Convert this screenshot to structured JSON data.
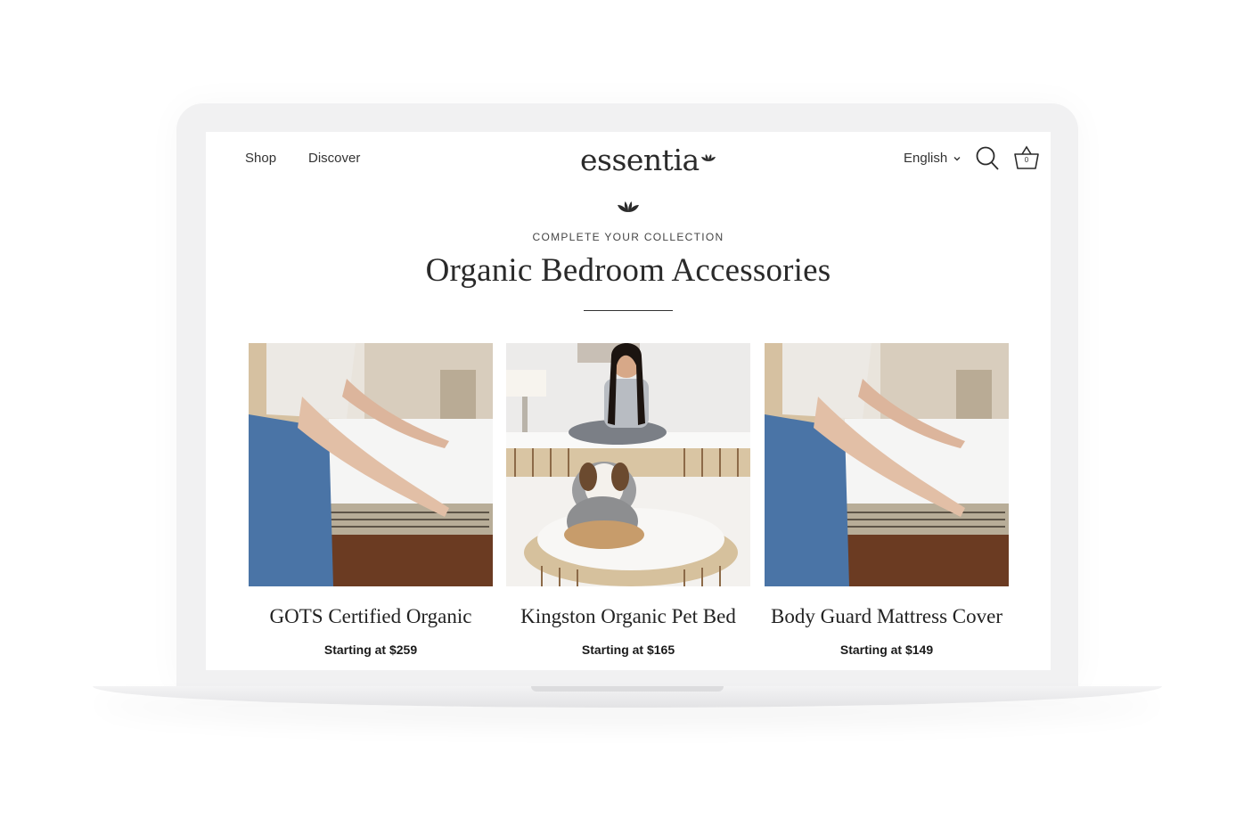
{
  "nav": {
    "shop_label": "Shop",
    "discover_label": "Discover",
    "logo_text": "essentia",
    "language_label": "English",
    "cart_count": "0"
  },
  "section": {
    "eyebrow": "COMPLETE YOUR COLLECTION",
    "title": "Organic Bedroom Accessories"
  },
  "products": [
    {
      "name": "GOTS Certified Organic",
      "price": "Starting at $259",
      "image": "photo-woman-fitting-mattress-protector"
    },
    {
      "name": "Kingston Organic Pet Bed",
      "price": "Starting at $165",
      "image": "photo-woman-with-dog-on-pet-bed"
    },
    {
      "name": "Body Guard Mattress Cover",
      "price": "Starting at $149",
      "image": "photo-woman-fitting-mattress-protector"
    }
  ],
  "colors": {
    "text": "#2a2a2a",
    "frame": "#f1f1f2",
    "background": "#ffffff"
  }
}
